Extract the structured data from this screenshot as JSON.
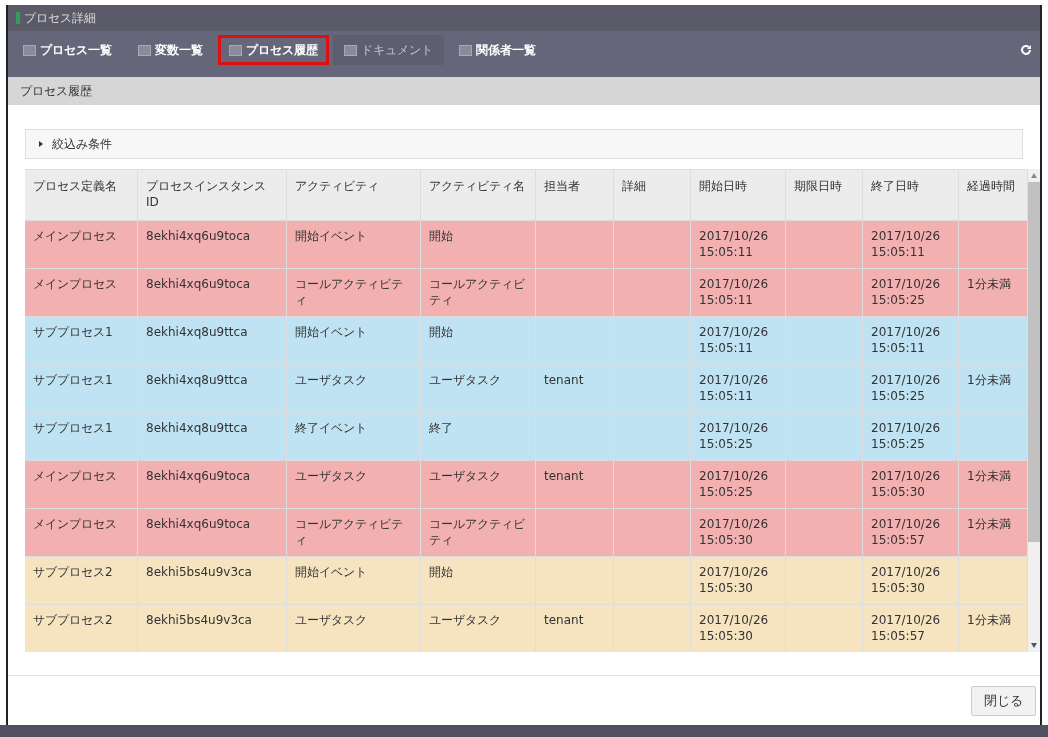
{
  "window": {
    "title": "プロセス詳細"
  },
  "tabs": [
    {
      "label": "プロセス一覧",
      "selected": false,
      "disabled": false
    },
    {
      "label": "変数一覧",
      "selected": false,
      "disabled": false
    },
    {
      "label": "プロセス履歴",
      "selected": true,
      "disabled": false
    },
    {
      "label": "ドキュメント",
      "selected": false,
      "disabled": true
    },
    {
      "label": "関係者一覧",
      "selected": false,
      "disabled": false
    }
  ],
  "section_title": "プロセス履歴",
  "filter": {
    "label": "絞込み条件",
    "expanded": false
  },
  "table": {
    "columns": [
      "プロセス定義名",
      "プロセスインスタンスID",
      "アクティビティ",
      "アクティビティ名",
      "担当者",
      "詳細",
      "開始日時",
      "期限日時",
      "終了日時",
      "経過時間"
    ],
    "rows": [
      {
        "color": "#f2b0b0",
        "cells": [
          "メインプロセス",
          "8ekhi4xq6u9toca",
          "開始イベント",
          "開始",
          "",
          "",
          "2017/10/26 15:05:11",
          "",
          "2017/10/26 15:05:11",
          ""
        ]
      },
      {
        "color": "#f2b0b0",
        "cells": [
          "メインプロセス",
          "8ekhi4xq6u9toca",
          "コールアクティビティ",
          "コールアクティビティ",
          "",
          "",
          "2017/10/26 15:05:11",
          "",
          "2017/10/26 15:05:25",
          "1分未満"
        ]
      },
      {
        "color": "#bfe3f2",
        "cells": [
          "サブプロセス1",
          "8ekhi4xq8u9ttca",
          "開始イベント",
          "開始",
          "",
          "",
          "2017/10/26 15:05:11",
          "",
          "2017/10/26 15:05:11",
          ""
        ]
      },
      {
        "color": "#bfe3f2",
        "cells": [
          "サブプロセス1",
          "8ekhi4xq8u9ttca",
          "ユーザタスク",
          "ユーザタスク",
          "tenant",
          "",
          "2017/10/26 15:05:11",
          "",
          "2017/10/26 15:05:25",
          "1分未満"
        ]
      },
      {
        "color": "#bfe3f2",
        "cells": [
          "サブプロセス1",
          "8ekhi4xq8u9ttca",
          "終了イベント",
          "終了",
          "",
          "",
          "2017/10/26 15:05:25",
          "",
          "2017/10/26 15:05:25",
          ""
        ]
      },
      {
        "color": "#f2b0b0",
        "cells": [
          "メインプロセス",
          "8ekhi4xq6u9toca",
          "ユーザタスク",
          "ユーザタスク",
          "tenant",
          "",
          "2017/10/26 15:05:25",
          "",
          "2017/10/26 15:05:30",
          "1分未満"
        ]
      },
      {
        "color": "#f2b0b0",
        "cells": [
          "メインプロセス",
          "8ekhi4xq6u9toca",
          "コールアクティビティ",
          "コールアクティビティ",
          "",
          "",
          "2017/10/26 15:05:30",
          "",
          "2017/10/26 15:05:57",
          "1分未満"
        ]
      },
      {
        "color": "#f6e3c0",
        "cells": [
          "サブプロセス2",
          "8ekhi5bs4u9v3ca",
          "開始イベント",
          "開始",
          "",
          "",
          "2017/10/26 15:05:30",
          "",
          "2017/10/26 15:05:30",
          ""
        ]
      },
      {
        "color": "#f6e3c0",
        "cells": [
          "サブプロセス2",
          "8ekhi5bs4u9v3ca",
          "ユーザタスク",
          "ユーザタスク",
          "tenant",
          "",
          "2017/10/26 15:05:30",
          "",
          "2017/10/26 15:05:57",
          "1分未満"
        ]
      }
    ]
  },
  "close_button": "閉じる"
}
